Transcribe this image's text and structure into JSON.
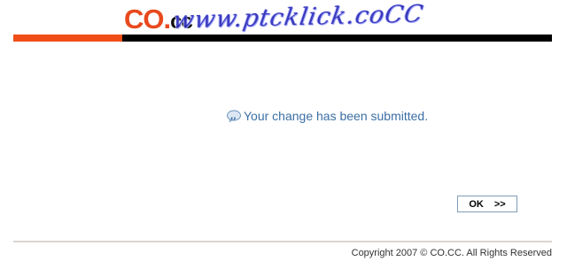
{
  "header": {
    "logo_co": "CO",
    "logo_dot": ".",
    "logo_cc": "cc",
    "watermark_text": "www.ptcklick.coCC",
    "brand_colors": {
      "orange": "#f04e18",
      "black": "#000000"
    }
  },
  "message": {
    "icon": "speech-bubble-icon",
    "text": "Your change has been submitted."
  },
  "actions": {
    "ok_label": "OK",
    "ok_arrow": ">>"
  },
  "footer": {
    "copyright": "Copyright 2007 © CO.CC. All Rights Reserved"
  }
}
